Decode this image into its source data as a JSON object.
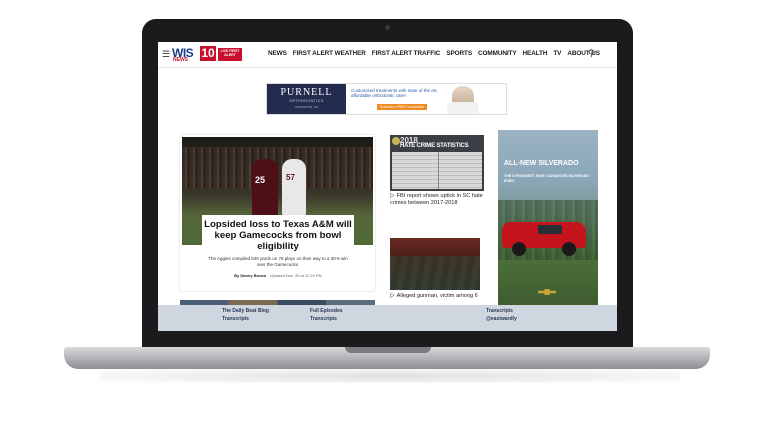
{
  "site": {
    "logo_text": "WIS",
    "logo_sub": "NEWS",
    "logo_channel": "10",
    "logo_tag": "LIVE FIRST ALERT"
  },
  "nav": {
    "items": [
      "NEWS",
      "FIRST ALERT WEATHER",
      "FIRST ALERT TRAFFIC",
      "SPORTS",
      "COMMUNITY",
      "HEALTH",
      "TV",
      "ABOUT US"
    ]
  },
  "ad_banner": {
    "brand": "PURNELL",
    "subtitle": "ORTHODONTICS",
    "location": "LEXINGTON, SC",
    "text": "Customized treatments with state of the art, affordable orthodontic care!",
    "cta": "Schedule a FREE Consultation",
    "doctor": "Dr. Tom Purnell"
  },
  "main_story": {
    "headline": "Lopsided loss to Texas A&M will keep Gamecocks from bowl eligibility",
    "summary": "The Aggies compiled 540 yards on 78 plays on their way to a 30-6 win over the Gamecocks.",
    "byline_author": "By Danny Brown",
    "byline_time": "· Updated Nov. 30 at 11:19 PM",
    "player1_number": "25",
    "player2_number": "57"
  },
  "side_stories": [
    {
      "thumb_year": "2018",
      "thumb_title": "HATE CRIME STATISTICS",
      "caption": "FBI report shows uptick in SC hate crimes between 2017-2018"
    },
    {
      "caption": "Alleged gunman, victim among 6"
    }
  ],
  "right_ad": {
    "title": "ALL-NEW SILVERADO",
    "subtitle": "THE STRONGEST, MOST ADVANCED SILVERADO EVER."
  },
  "footer": {
    "links": [
      "The Daily Beat Blog",
      "Transcripts",
      "Full Episodes",
      "Transcripts",
      "Transcripts",
      "@eastwardly"
    ]
  },
  "colors": {
    "brand_blue": "#1a3a8a",
    "brand_red": "#c8102e",
    "truck_red": "#c4151c"
  }
}
